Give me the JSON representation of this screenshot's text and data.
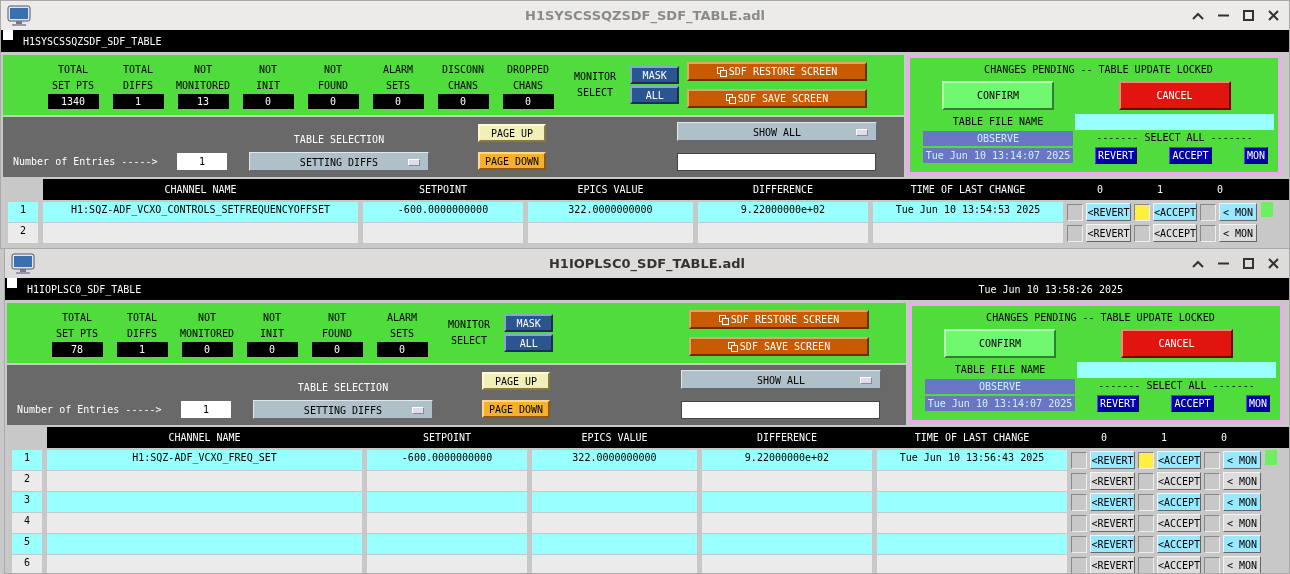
{
  "windows": [
    {
      "title": "H1SYSCSSQZSDF_SDF_TABLE.adl",
      "active": false,
      "screen_name": "H1SYSCSSQZSDF_SDF_TABLE",
      "stats": [
        {
          "label_lines": [
            "TOTAL",
            "SET PTS"
          ],
          "value": "1340"
        },
        {
          "label_lines": [
            "TOTAL",
            "DIFFS"
          ],
          "value": "1"
        },
        {
          "label_lines": [
            "NOT",
            "MONITORED"
          ],
          "value": "13"
        },
        {
          "label_lines": [
            "NOT",
            "INIT"
          ],
          "value": "0"
        },
        {
          "label_lines": [
            "NOT",
            "FOUND"
          ],
          "value": "0"
        },
        {
          "label_lines": [
            "ALARM",
            "SETS"
          ],
          "value": "0"
        },
        {
          "label_lines": [
            "DISCONN",
            "CHANS"
          ],
          "value": "0"
        },
        {
          "label_lines": [
            "DROPPED",
            "CHANS"
          ],
          "value": "0"
        }
      ],
      "monitor_label_lines": [
        "MONITOR",
        "SELECT"
      ],
      "monitor_buttons": [
        "MASK",
        "ALL"
      ],
      "restore_button": "SDF RESTORE SCREEN",
      "save_button": "SDF SAVE SCREEN",
      "entries_label": "Number of Entries ----->",
      "entries_value": "1",
      "table_selection_label": "TABLE SELECTION",
      "table_selection": "SETTING DIFFS",
      "page_up": "PAGE UP",
      "page_down": "PAGE DOWN",
      "show_selection": "SHOW ALL",
      "pending": {
        "title": "CHANGES PENDING -- TABLE UPDATE LOCKED",
        "confirm": "CONFIRM",
        "cancel": "CANCEL",
        "file_name_label": "TABLE FILE NAME",
        "file": "OBSERVE",
        "file_date": "Tue Jun 10 13:14:07 2025",
        "select_all_label": "------- SELECT ALL -------",
        "select_all_buttons": [
          "REVERT",
          "ACCEPT",
          "MON"
        ]
      },
      "columns": [
        "CHANNEL NAME",
        "SETPOINT",
        "EPICS VALUE",
        "DIFFERENCE",
        "TIME OF LAST CHANGE"
      ],
      "toggle_counts": [
        "0",
        "1",
        "0"
      ],
      "rows": [
        {
          "number": "1",
          "cells": [
            "H1:SQZ-ADF_VCXO_CONTROLS_SETFREQUENCYOFFSET",
            "-600.0000000000",
            "322.0000000000",
            "9.22000000e+02",
            "Tue Jun 10 13:54:53 2025"
          ],
          "actions": [
            {
              "label": "<REVERT",
              "checked": false
            },
            {
              "label": "<ACCEPT",
              "checked": true
            },
            {
              "label": "< MON",
              "checked": false
            }
          ],
          "flagged": true
        },
        {
          "number": "2",
          "actions": [
            {
              "label": "<REVERT",
              "checked": false
            },
            {
              "label": "<ACCEPT",
              "checked": false
            },
            {
              "label": "< MON",
              "checked": false
            }
          ],
          "flagged": false
        }
      ]
    },
    {
      "title": "H1IOPLSC0_SDF_TABLE.adl",
      "active": true,
      "screen_name": "H1IOPLSC0_SDF_TABLE",
      "date": "Tue Jun 10 13:58:26 2025",
      "stats": [
        {
          "label_lines": [
            "TOTAL",
            "SET PTS"
          ],
          "value": "78"
        },
        {
          "label_lines": [
            "TOTAL",
            "DIFFS"
          ],
          "value": "1"
        },
        {
          "label_lines": [
            "NOT",
            "MONITORED"
          ],
          "value": "0"
        },
        {
          "label_lines": [
            "NOT",
            "INIT"
          ],
          "value": "0"
        },
        {
          "label_lines": [
            "NOT",
            "FOUND"
          ],
          "value": "0"
        },
        {
          "label_lines": [
            "ALARM",
            "SETS"
          ],
          "value": "0"
        }
      ],
      "monitor_label_lines": [
        "MONITOR",
        "SELECT"
      ],
      "monitor_buttons": [
        "MASK",
        "ALL"
      ],
      "restore_button": "SDF RESTORE SCREEN",
      "save_button": "SDF SAVE SCREEN",
      "entries_label": "Number of Entries ----->",
      "entries_value": "1",
      "table_selection_label": "TABLE SELECTION",
      "table_selection": "SETTING DIFFS",
      "page_up": "PAGE UP",
      "page_down": "PAGE DOWN",
      "show_selection": "SHOW ALL",
      "pending": {
        "title": "CHANGES PENDING -- TABLE UPDATE LOCKED",
        "confirm": "CONFIRM",
        "cancel": "CANCEL",
        "file_name_label": "TABLE FILE NAME",
        "file": "OBSERVE",
        "file_date": "Tue Jun 10 13:14:07 2025",
        "select_all_label": "------- SELECT ALL -------",
        "select_all_buttons": [
          "REVERT",
          "ACCEPT",
          "MON"
        ]
      },
      "columns": [
        "CHANNEL NAME",
        "SETPOINT",
        "EPICS VALUE",
        "DIFFERENCE",
        "TIME OF LAST CHANGE"
      ],
      "toggle_counts": [
        "0",
        "1",
        "0"
      ],
      "rows": [
        {
          "number": "1",
          "cells": [
            "H1:SQZ-ADF_VCXO_FREQ_SET",
            "-600.0000000000",
            "322.0000000000",
            "9.22000000e+02",
            "Tue Jun 10 13:56:43 2025"
          ],
          "actions": [
            {
              "label": "<REVERT",
              "checked": false
            },
            {
              "label": "<ACCEPT",
              "checked": true
            },
            {
              "label": "< MON",
              "checked": false
            }
          ],
          "flagged": true
        },
        {
          "number": "2",
          "actions": [
            {
              "label": "<REVERT",
              "checked": false
            },
            {
              "label": "<ACCEPT",
              "checked": false
            },
            {
              "label": "< MON",
              "checked": false
            }
          ],
          "flagged": false
        },
        {
          "number": "3",
          "actions": [
            {
              "label": "<REVERT",
              "checked": false
            },
            {
              "label": "<ACCEPT",
              "checked": false
            },
            {
              "label": "< MON",
              "checked": false
            }
          ],
          "flagged": false
        },
        {
          "number": "4",
          "actions": [
            {
              "label": "<REVERT",
              "checked": false
            },
            {
              "label": "<ACCEPT",
              "checked": false
            },
            {
              "label": "< MON",
              "checked": false
            }
          ],
          "flagged": false
        },
        {
          "number": "5",
          "actions": [
            {
              "label": "<REVERT",
              "checked": false
            },
            {
              "label": "<ACCEPT",
              "checked": false
            },
            {
              "label": "< MON",
              "checked": false
            }
          ],
          "flagged": false
        },
        {
          "number": "6",
          "actions": [
            {
              "label": "<REVERT",
              "checked": false
            },
            {
              "label": "<ACCEPT",
              "checked": false
            },
            {
              "label": "< MON",
              "checked": false
            }
          ],
          "flagged": false
        }
      ]
    }
  ]
}
